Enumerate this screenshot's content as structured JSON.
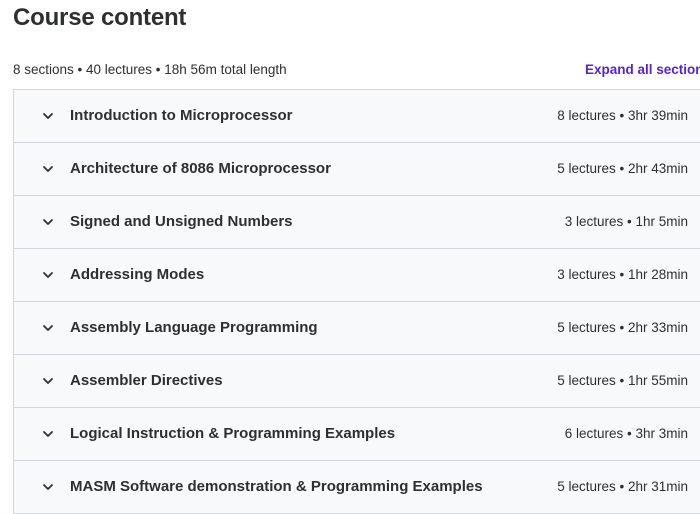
{
  "header": {
    "title": "Course content"
  },
  "summary": {
    "text": "8 sections • 40 lectures • 18h 56m total length",
    "expand_all_label": "Expand all sections"
  },
  "colors": {
    "accent": "#5624d0",
    "row_background": "#f7f9fa",
    "border": "#d1d7dc",
    "text": "#2d2f31"
  },
  "sections": [
    {
      "title": "Introduction to Microprocessor",
      "meta": "8 lectures • 3hr 39min",
      "icon": "chevron-down-icon"
    },
    {
      "title": "Architecture of 8086 Microprocessor",
      "meta": "5 lectures • 2hr 43min",
      "icon": "chevron-down-icon"
    },
    {
      "title": "Signed and Unsigned Numbers",
      "meta": "3 lectures • 1hr 5min",
      "icon": "chevron-down-icon"
    },
    {
      "title": "Addressing Modes",
      "meta": "3 lectures • 1hr 28min",
      "icon": "chevron-down-icon"
    },
    {
      "title": "Assembly Language Programming",
      "meta": "5 lectures • 2hr 33min",
      "icon": "chevron-down-icon"
    },
    {
      "title": "Assembler Directives",
      "meta": "5 lectures • 1hr 55min",
      "icon": "chevron-down-icon"
    },
    {
      "title": "Logical Instruction & Programming Examples",
      "meta": "6 lectures • 3hr 3min",
      "icon": "chevron-down-icon"
    },
    {
      "title": "MASM Software demonstration & Programming Examples",
      "meta": "5 lectures • 2hr 31min",
      "icon": "chevron-down-icon"
    }
  ]
}
